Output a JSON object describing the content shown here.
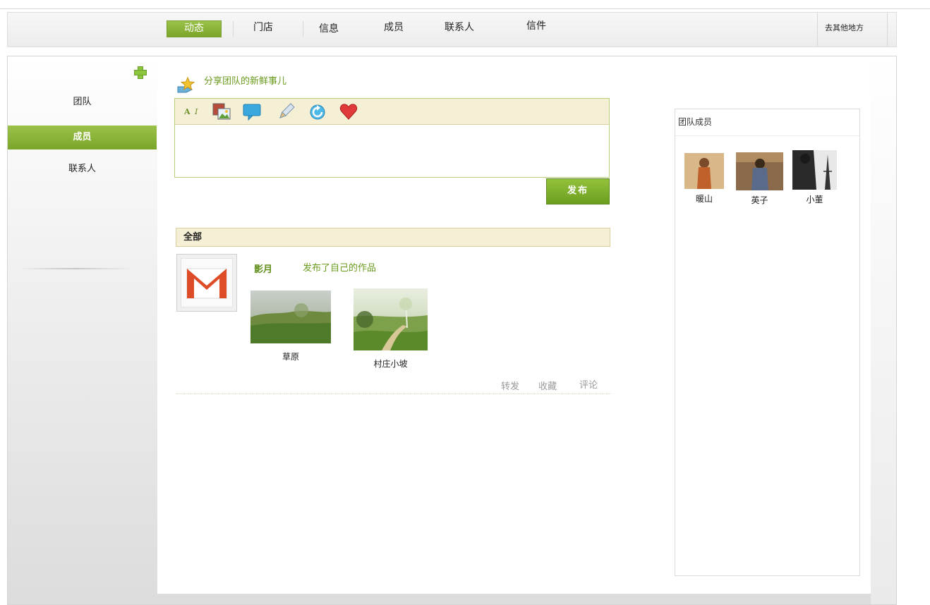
{
  "nav": {
    "items": [
      "动态",
      "门店",
      "信息",
      "成员",
      "联系人",
      "信件"
    ],
    "active_index": 0,
    "other_place": "去其他地方"
  },
  "sidebar": {
    "items": [
      "团队",
      "成员",
      "联系人"
    ],
    "active_index": 1,
    "add_icon": "plus-icon"
  },
  "composer": {
    "title": "分享团队的新鲜事儿",
    "toolbar_icons": [
      "text-format-icon",
      "image-icon",
      "speech-bubble-icon",
      "pencil-icon",
      "refresh-icon",
      "heart-icon"
    ],
    "text_value": "",
    "publish_label": "发布"
  },
  "feed": {
    "filter_label": "全部",
    "post": {
      "user": "影月",
      "action": "发布了自己的作品",
      "avatar_icon": "gmail-icon",
      "works": [
        {
          "caption": "草原"
        },
        {
          "caption": "村庄小坡"
        }
      ],
      "links": [
        "转发",
        "收藏",
        "评论"
      ]
    }
  },
  "members_panel": {
    "title": "团队成员",
    "members": [
      {
        "name": "暖山"
      },
      {
        "name": "英子"
      },
      {
        "name": "小董"
      }
    ]
  },
  "colors": {
    "accent_green": "#7aa52a",
    "link_green": "#6a9b1e",
    "toolbar_beige": "#f5efd5"
  }
}
